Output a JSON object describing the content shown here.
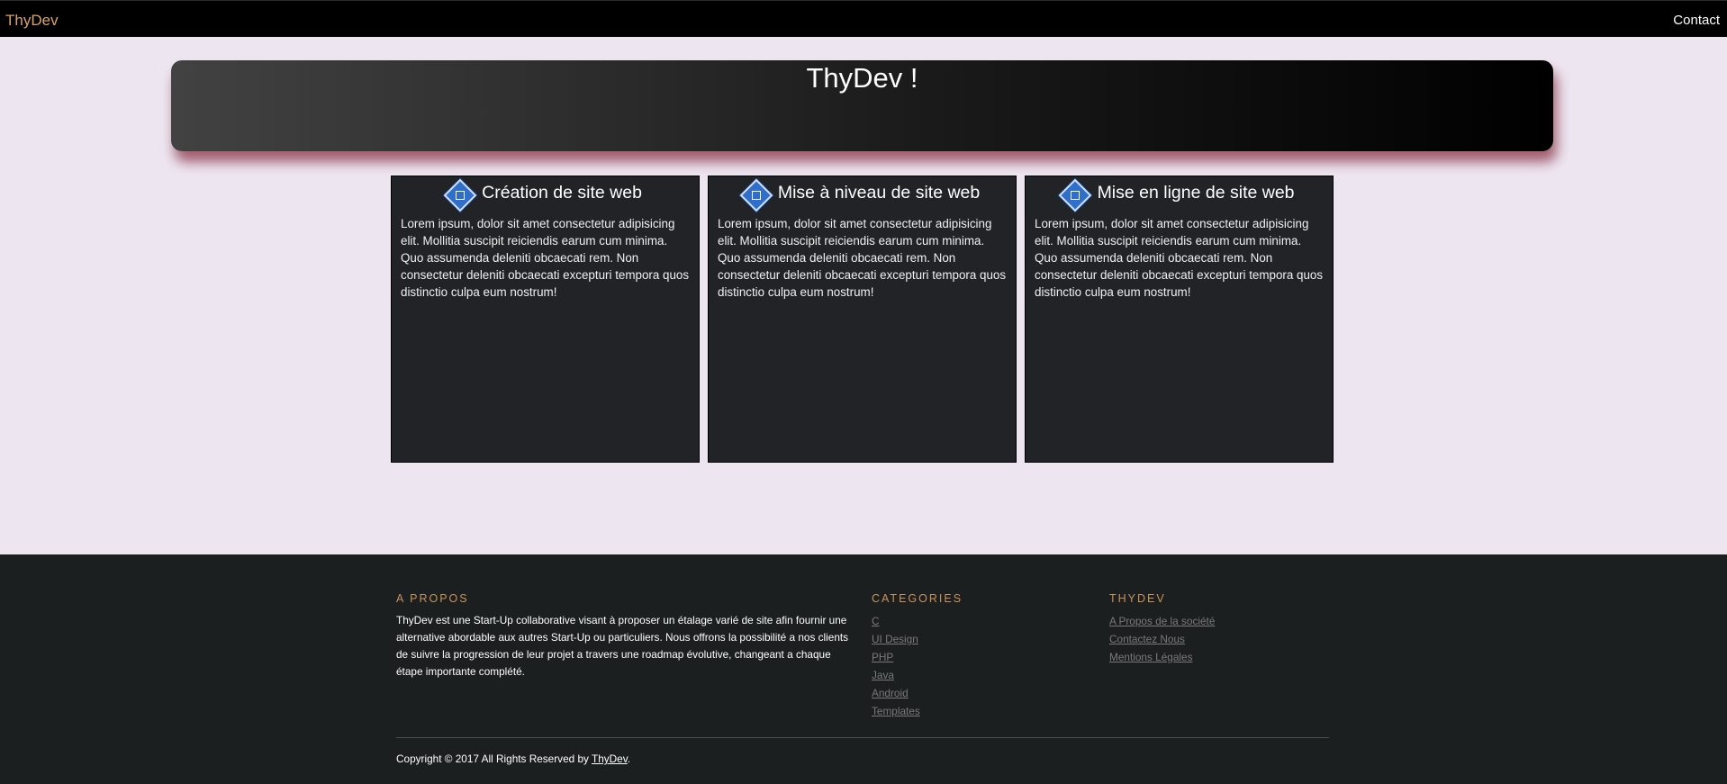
{
  "navbar": {
    "brand": "ThyDev",
    "contact": "Contact"
  },
  "hero": {
    "title": "ThyDev !"
  },
  "cards": [
    {
      "icon": "diamond-app-icon",
      "title": "Création de site web",
      "text": "Lorem ipsum, dolor sit amet consectetur adipisicing elit. Mollitia suscipit reiciendis earum cum minima. Quo assumenda deleniti obcaecati rem. Non consectetur deleniti obcaecati excepturi tempora quos distinctio culpa eum nostrum!"
    },
    {
      "icon": "diamond-app-icon",
      "title": "Mise à niveau de site web",
      "text": "Lorem ipsum, dolor sit amet consectetur adipisicing elit. Mollitia suscipit reiciendis earum cum minima. Quo assumenda deleniti obcaecati rem. Non consectetur deleniti obcaecati excepturi tempora quos distinctio culpa eum nostrum!"
    },
    {
      "icon": "diamond-app-icon",
      "title": "Mise en ligne de site web",
      "text": "Lorem ipsum, dolor sit amet consectetur adipisicing elit. Mollitia suscipit reiciendis earum cum minima. Quo assumenda deleniti obcaecati rem. Non consectetur deleniti obcaecati excepturi tempora quos distinctio culpa eum nostrum!"
    }
  ],
  "footer": {
    "about": {
      "heading": "A PROPOS",
      "text": "ThyDev est une Start-Up collaborative visant à proposer un étalage varié de site afin fournir une alternative abordable aux autres Start-Up ou particuliers. Nous offrons la possibilité a nos clients de suivre la progression de leur projet a travers une roadmap évolutive, changeant a chaque étape importante complété."
    },
    "categories": {
      "heading": "CATEGORIES",
      "links": [
        "C",
        "UI Design",
        "PHP",
        "Java",
        "Android",
        "Templates"
      ]
    },
    "thydev": {
      "heading": "THYDEV",
      "links": [
        "A Propos de la société",
        "Contactez Nous",
        "Mentions Légales"
      ]
    },
    "copyright_prefix": "Copyright © 2017 All Rights Reserved by ",
    "copyright_link": "ThyDev",
    "copyright_suffix": "."
  },
  "colors": {
    "page_bg": "#ede6f1",
    "nav_bg": "#000000",
    "brand": "#d9a36a",
    "card_bg": "#212327",
    "footer_bg": "#1b1f1f",
    "footer_heading": "#c8935d",
    "footer_link": "#7a7a7a"
  }
}
